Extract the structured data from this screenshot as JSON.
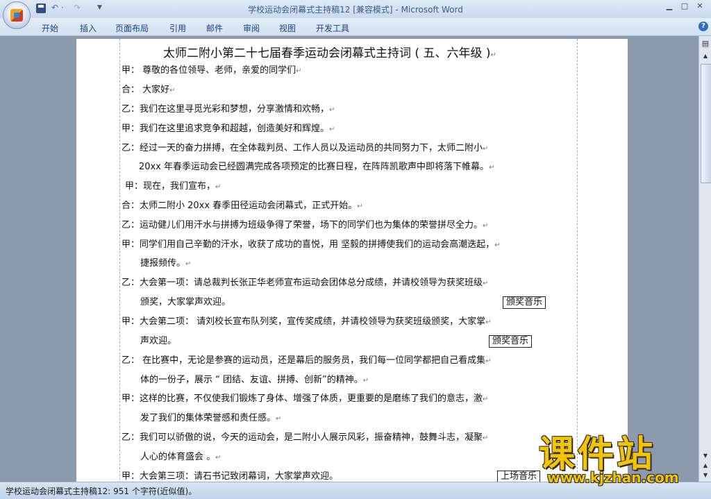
{
  "window": {
    "title": "学校运动会闭幕式主持稿12 [兼容模式] - Microsoft Word",
    "min_glyph": "▁",
    "max_glyph": "□",
    "close_glyph": "✕"
  },
  "quick_access": {
    "undo_glyph": "↶ ·",
    "redo_glyph": "↷",
    "menu_glyph": "▼"
  },
  "ribbon": {
    "tabs": [
      "开始",
      "插入",
      "页面布局",
      "引用",
      "邮件",
      "审阅",
      "视图",
      "开发工具"
    ],
    "help_glyph": "?"
  },
  "document": {
    "title": "太师二附小第二十七届春季运动会闭幕式主持词 ( 五、六年级 )",
    "paragraph_mark": "↵",
    "lines": [
      "甲： 尊敬的各位领导、老师，亲爱的同学们",
      "合： 大家好",
      "乙：我们在这里寻觅光彩和梦想，分享激情和欢畅，",
      "甲：我们在这里追求竞争和超越，创造美好和辉煌。",
      "乙：经过一天的奋力拼搏，在全体裁判员、工作人员以及运动员的共同努力下，太师二附小",
      "20xx 年春季运动会已经圆满完成各项预定的比赛日程，在阵阵凯歌声中即将落下帷幕。",
      "甲：现在，我们宣布，",
      "合：太师二附小 20xx 春季田径运动会闭幕式，正式开始。",
      "乙：运动健儿们用汗水与拼搏为班级争得了荣誉，场下的同学们也为集体的荣誉拼尽全力。",
      "甲：同学们用自己辛勤的汗水，收获了成功的喜悦，用 坚毅的拼搏使我们的运动会高潮迭起，",
      "捷报频传。",
      "乙：大会第一项：请总裁判长张正华老师宣布运动会团体总分成绩，并请校领导为获奖班级",
      "颁奖，大家掌声欢迎。",
      "甲：大会第二项： 请刘校长宣布队列奖，宣传奖成绩，并请校领导为获奖班级颁奖，大家掌",
      "声欢迎。",
      "乙： 在比赛中，无论是参赛的运动员，还是幕后的服务员，我们每一位同学都把自己看成集",
      "体的一份子，展示 “ 团结、友谊、拼搏、创新”的精神。",
      "甲：这样的比赛，不仅使我们锻炼了身体、增强了体质，更重要的是磨练了我们的意志，激",
      "发了我们的集体荣誉感和责任感。",
      "乙：我们可以骄傲的说，今天的运动会，是二附小人展示风彩，振奋精神，鼓舞斗志，凝聚",
      "人心的体育盛会 。",
      "甲：大会第三项：请石书记致闭幕词，大家掌声欢迎。"
    ],
    "music_notes": [
      "颁奖音乐",
      "颁奖音乐",
      "上场音乐"
    ]
  },
  "status_bar": {
    "text": "学校运动会闭幕式主持稿12: 951 个字符(近似值)。"
  },
  "watermark": {
    "title": "课件站",
    "url": "www.kjzhan.com"
  }
}
